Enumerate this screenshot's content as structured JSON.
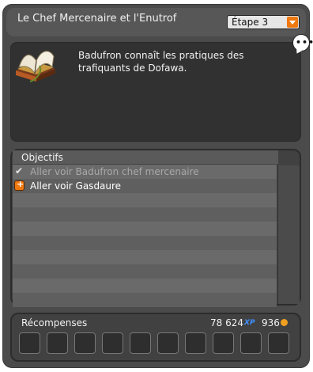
{
  "header": {
    "title": "Le Chef Mercenaire et l'Enutrof",
    "step_label": "Étape 3"
  },
  "description": {
    "text": "Badufron connaît les pratiques des trafiquants de Dofawa.",
    "icon": "open-book-icon"
  },
  "objectives": {
    "title": "Objectifs",
    "items": [
      {
        "label": "Aller voir Badufron chef mercenaire",
        "status": "done",
        "icon": "check-icon"
      },
      {
        "label": "Aller voir Gasdaure",
        "status": "active",
        "icon": "target-icon"
      }
    ]
  },
  "rewards": {
    "title": "Récompenses",
    "xp": "78 624",
    "kamas": "936",
    "xp_icon": "xp-icon",
    "kamas_icon": "kamas-icon",
    "slot_count": 10
  },
  "colors": {
    "accent_orange": "#f07810",
    "panel_bg": "#4b4b4b",
    "xp_blue": "#3f8fff"
  }
}
